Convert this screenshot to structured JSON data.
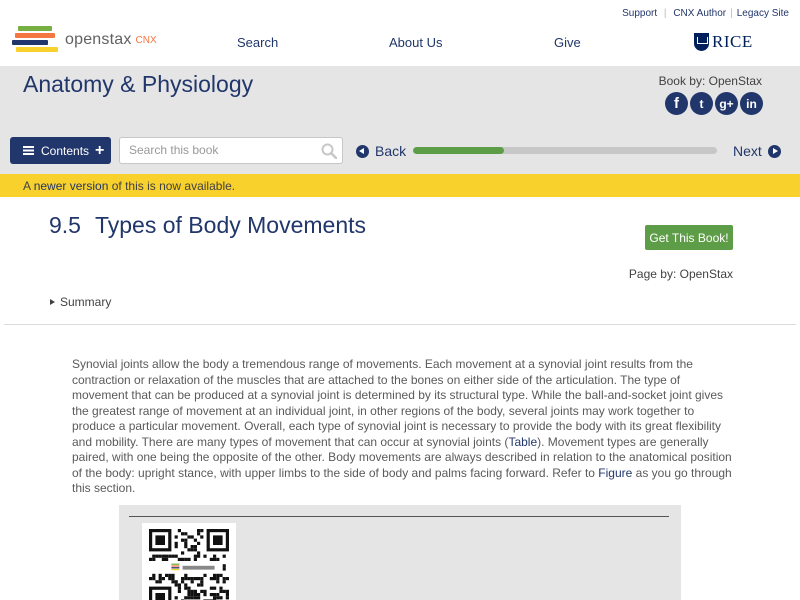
{
  "header": {
    "logo_text": "openstax",
    "logo_suffix": "CNX",
    "utility_links": [
      "Support",
      "CNX Author",
      "Legacy Site"
    ],
    "nav": [
      "Search",
      "About Us",
      "Give"
    ],
    "partner": "RICE"
  },
  "book": {
    "title": "Anatomy & Physiology",
    "book_by": "Book by: OpenStax",
    "social": [
      "facebook-icon",
      "twitter-icon",
      "google-plus-icon",
      "linkedin-icon"
    ],
    "social_glyphs": [
      "f",
      "t",
      "g+",
      "in"
    ]
  },
  "toolbar": {
    "contents_label": "Contents",
    "search_placeholder": "Search this book",
    "back_label": "Back",
    "next_label": "Next",
    "progress_fraction": 0.3
  },
  "notice": {
    "prefix": "A ",
    "link": "newer version",
    "suffix": " of this is now available."
  },
  "page": {
    "number": "9.5",
    "title": "Types of Body Movements",
    "get_book": "Get This Book!",
    "page_by": "Page by: OpenStax",
    "summary": "Summary"
  },
  "content": {
    "p1": "Synovial joints allow the body a tremendous range of movements. Each movement at a synovial joint results from the contraction or relaxation of the muscles that are attached to the bones on either side of the articulation. The type of movement that can be produced at a synovial joint is determined by its structural type. While the ball-and-socket joint gives the greatest range of movement at an individual joint, in other regions of the body, several joints may work together to produce a particular movement. Overall, each type of synovial joint is necessary to provide the body with its great flexibility and mobility. There are many types of movement that can occur at synovial joints (",
    "link_table": "Table",
    "p2": "). Movement types are generally paired, with one being the opposite of the other. Body movements are always described in relation to the anatomical position of the body: upright stance, with upper limbs to the side of body and palms facing forward. Refer to ",
    "link_figure": "Figure",
    "p3": " as you go through this section."
  },
  "colors": {
    "brand_blue": "#21366b",
    "progress_green": "#5e9d48",
    "notice_yellow": "#f8d12d",
    "header_gray": "#e5e5e5"
  }
}
